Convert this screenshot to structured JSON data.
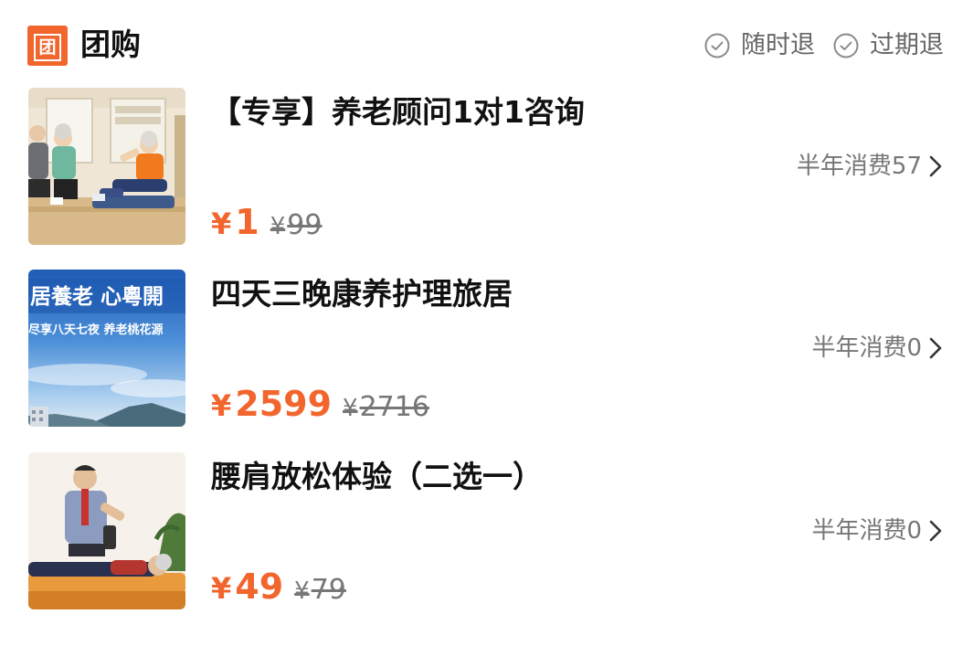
{
  "header": {
    "logo_char": "团",
    "title": "团购",
    "policies": [
      {
        "label": "随时退",
        "icon": "check-circle-icon"
      },
      {
        "label": "过期退",
        "icon": "check-circle-icon"
      }
    ]
  },
  "colors": {
    "accent": "#f2652d",
    "muted": "#777777",
    "text": "#111111"
  },
  "items": [
    {
      "title": "【专享】养老顾问1对1咨询",
      "sales": "半年消费57",
      "price_symbol": "¥",
      "price": "1",
      "orig_symbol": "¥",
      "orig_price": "99",
      "image": "elderly-exercise-photo"
    },
    {
      "title": "四天三晚康养护理旅居",
      "sales": "半年消费0",
      "price_symbol": "¥",
      "price": "2599",
      "orig_symbol": "¥",
      "orig_price": "2716",
      "image": "sky-mountain-banner",
      "image_text_top": "居養老 心粵開",
      "image_text_sub": "尽享八天七夜 养老桃花源"
    },
    {
      "title": "腰肩放松体验（二选一）",
      "sales": "半年消费0",
      "price_symbol": "¥",
      "price": "49",
      "orig_symbol": "¥",
      "orig_price": "79",
      "image": "massage-therapy-photo"
    }
  ]
}
